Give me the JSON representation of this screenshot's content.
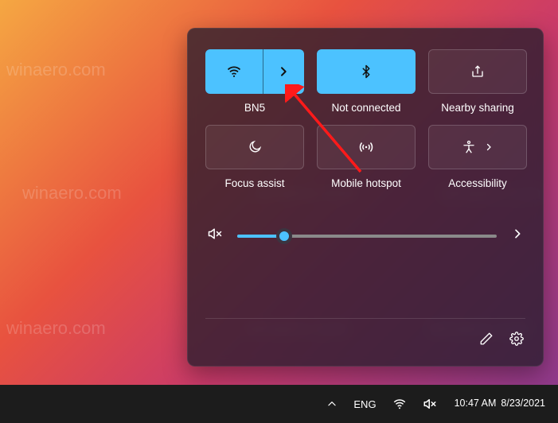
{
  "watermark_text": "winaero.com",
  "quick_settings": {
    "tiles": [
      {
        "id": "wifi",
        "label": "BN5",
        "active": true,
        "has_chevron": true,
        "icon": "wifi-icon"
      },
      {
        "id": "bluetooth",
        "label": "Not connected",
        "active": true,
        "has_chevron": false,
        "icon": "bluetooth-icon"
      },
      {
        "id": "nearby",
        "label": "Nearby sharing",
        "active": false,
        "has_chevron": false,
        "icon": "share-icon"
      },
      {
        "id": "focus",
        "label": "Focus assist",
        "active": false,
        "has_chevron": false,
        "icon": "moon-icon"
      },
      {
        "id": "hotspot",
        "label": "Mobile hotspot",
        "active": false,
        "has_chevron": false,
        "icon": "hotspot-icon"
      },
      {
        "id": "accessibility",
        "label": "Accessibility",
        "active": false,
        "has_chevron": true,
        "icon": "accessibility-icon"
      }
    ],
    "volume": {
      "muted": true,
      "value": 18,
      "max": 100
    }
  },
  "taskbar": {
    "language": "ENG",
    "time": "10:47 AM",
    "date": "8/23/2021"
  },
  "colors": {
    "accent": "#4cc2ff",
    "panel": "rgba(40,30,45,0.78)"
  }
}
